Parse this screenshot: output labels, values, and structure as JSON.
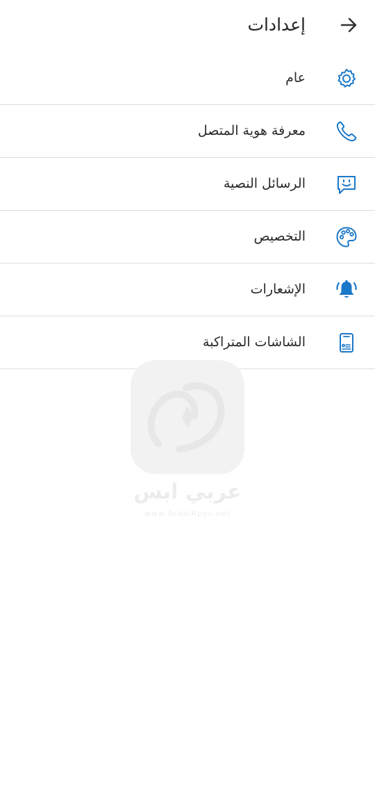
{
  "header": {
    "title": "إعدادات",
    "back_icon": "arrow-back-icon"
  },
  "menu": {
    "items": [
      {
        "label": "عام",
        "icon": "gear-icon"
      },
      {
        "label": "معرفة هوية المتصل",
        "icon": "phone-icon"
      },
      {
        "label": "الرسائل النصية",
        "icon": "message-smile-icon"
      },
      {
        "label": "التخصيص",
        "icon": "palette-icon"
      },
      {
        "label": "الإشعارات",
        "icon": "bell-ringing-icon"
      },
      {
        "label": "الشاشات المتراكبة",
        "icon": "phone-overlay-icon"
      }
    ]
  },
  "watermark": {
    "name": "عربي ابس",
    "url": "www.ArabiApps.net"
  },
  "colors": {
    "accent": "#1a78c8",
    "text": "#222222",
    "divider": "#dcdcdc",
    "background": "#ffffff"
  }
}
